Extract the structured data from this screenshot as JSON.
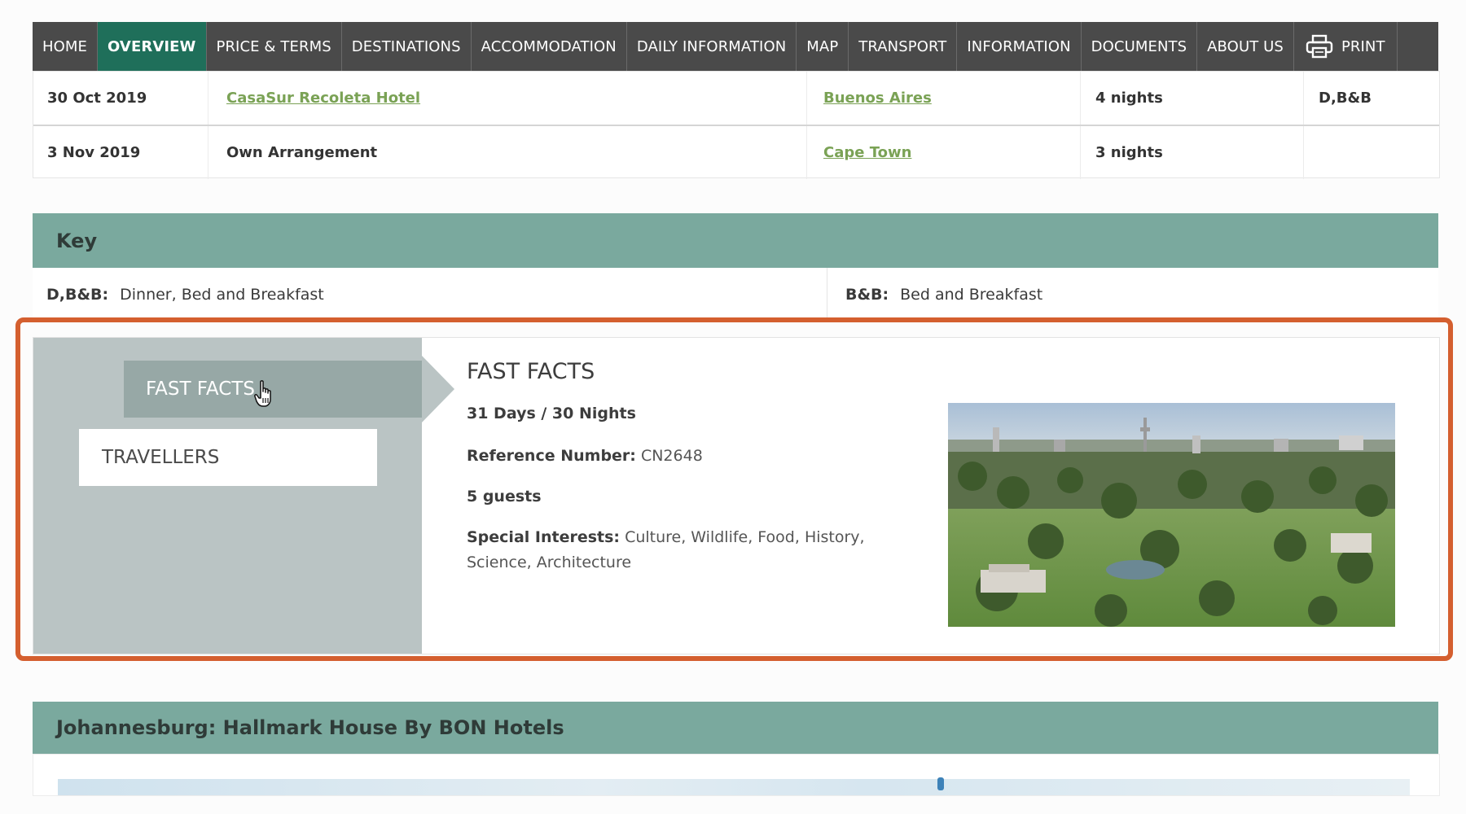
{
  "nav": {
    "items": [
      {
        "label": "HOME"
      },
      {
        "label": "OVERVIEW",
        "active": true
      },
      {
        "label": "PRICE & TERMS"
      },
      {
        "label": "DESTINATIONS"
      },
      {
        "label": "ACCOMMODATION"
      },
      {
        "label": "DAILY INFORMATION"
      },
      {
        "label": "MAP"
      },
      {
        "label": "TRANSPORT"
      },
      {
        "label": "INFORMATION"
      },
      {
        "label": "DOCUMENTS"
      },
      {
        "label": "ABOUT US"
      },
      {
        "label": "PRINT",
        "icon": "printer-icon"
      }
    ],
    "active_color": "#1f6f5a",
    "bg_color": "#4a4a4a"
  },
  "itinerary": {
    "rows": [
      {
        "date": "30 Oct 2019",
        "accommodation": "CasaSur Recoleta Hotel",
        "destination": "Buenos Aires",
        "nights": "4 nights",
        "basis": "D,B&B"
      },
      {
        "date": "3 Nov 2019",
        "accommodation": "Own Arrangement",
        "destination": "Cape Town",
        "nights": "3 nights",
        "basis": ""
      }
    ]
  },
  "key": {
    "title": "Key",
    "entries": [
      {
        "code": "D,B&B:",
        "meaning": "Dinner, Bed and Breakfast"
      },
      {
        "code": "B&B:",
        "meaning": "Bed and Breakfast"
      }
    ]
  },
  "fast_facts": {
    "tabs": [
      "FAST FACTS",
      "TRAVELLERS"
    ],
    "title": "FAST FACTS",
    "duration": "31 Days / 30 Nights",
    "reference_label": "Reference Number:",
    "reference_value": "CN2648",
    "guests": "5 guests",
    "interests_label": "Special Interests:",
    "interests_value": "Culture, Wildlife, Food, History, Science, Architecture",
    "highlight_color": "#d45f2f"
  },
  "hotel_section": {
    "title": "Johannesburg: Hallmark House By BON Hotels"
  }
}
